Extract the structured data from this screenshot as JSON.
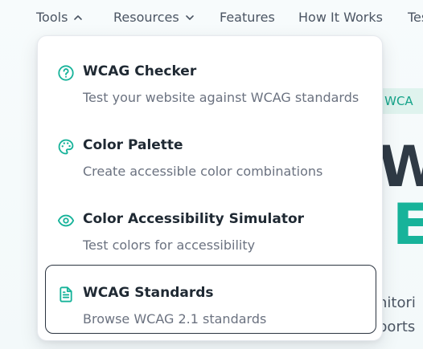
{
  "nav": {
    "items": [
      {
        "label": "Tools",
        "has_chevron": true,
        "chevron": "chevron-up-icon"
      },
      {
        "label": "Resources",
        "has_chevron": true,
        "chevron": "chevron-down-icon"
      },
      {
        "label": "Features"
      },
      {
        "label": "How It Works"
      },
      {
        "label": "Tes"
      }
    ]
  },
  "hero": {
    "badge": "or WCA",
    "line1": "W",
    "line2": "E",
    "text1": "nitori",
    "text2": "ports"
  },
  "tools_menu": {
    "items": [
      {
        "icon": "help-circle-icon",
        "title": "WCAG Checker",
        "description": "Test your website against WCAG standards"
      },
      {
        "icon": "palette-icon",
        "title": "Color Palette",
        "description": "Create accessible color combinations"
      },
      {
        "icon": "eye-icon",
        "title": "Color Accessibility Simulator",
        "description": "Test colors for accessibility"
      },
      {
        "icon": "document-icon",
        "title": "WCAG Standards",
        "description": "Browse WCAG 2.1 standards",
        "active": true
      }
    ]
  },
  "colors": {
    "accent": "#17b39a",
    "text_dark": "#1f2933",
    "text_muted": "#6b7280"
  }
}
